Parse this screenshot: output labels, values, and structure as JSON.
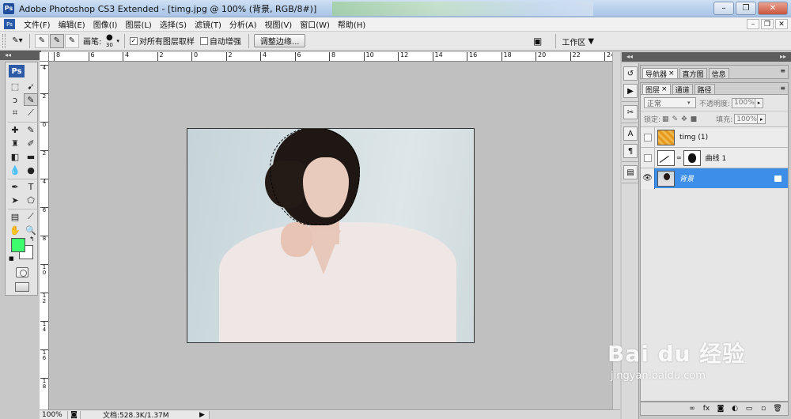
{
  "window": {
    "title": "Adobe Photoshop CS3 Extended - [timg.jpg @ 100% (背景, RGB/8#)]",
    "app_icon": "Ps"
  },
  "menu": {
    "items": [
      "文件(F)",
      "编辑(E)",
      "图像(I)",
      "图层(L)",
      "选择(S)",
      "滤镜(T)",
      "分析(A)",
      "视图(V)",
      "窗口(W)",
      "帮助(H)"
    ]
  },
  "options": {
    "brush_label": "画笔:",
    "brush_size": "30",
    "sample_all_layers": "对所有图层取样",
    "sample_all_layers_checked": true,
    "auto_enhance": "自动增强",
    "auto_enhance_checked": false,
    "refine_edge": "调整边缘...",
    "workspace": "工作区"
  },
  "toolbox": {
    "badge": "Ps",
    "foreground_color": "#3cff6b",
    "background_color": "#ffffff",
    "text_tool_glyph": "T"
  },
  "rulers": {
    "top": [
      "8",
      "6",
      "4",
      "2",
      "0",
      "2",
      "4",
      "6",
      "8",
      "10",
      "12",
      "14",
      "16",
      "18",
      "20",
      "22",
      "24"
    ],
    "left": [
      "4",
      "2",
      "0",
      "2",
      "4",
      "6",
      "8",
      "1 0",
      "1 2",
      "1 4",
      "1 6",
      "1 8"
    ]
  },
  "status": {
    "zoom": "100%",
    "doc": "文档:528.3K/1.37M"
  },
  "panels": {
    "top_tabs": [
      "导航器",
      "直方图",
      "信息"
    ],
    "layer_tabs": [
      "图层",
      "通道",
      "路径"
    ],
    "blend_mode": "正常",
    "opacity_label": "不透明度:",
    "opacity_value": "100%",
    "lock_label": "锁定:",
    "fill_label": "填充:",
    "fill_value": "100%",
    "layers": [
      {
        "name": "timg (1)",
        "visible": false,
        "selected": false
      },
      {
        "name": "曲线 1",
        "visible": false,
        "selected": false
      },
      {
        "name": "背景",
        "visible": true,
        "selected": true
      }
    ]
  },
  "watermark": {
    "brand": "Bai du 经验",
    "url": "jingyan.baidu.com"
  }
}
